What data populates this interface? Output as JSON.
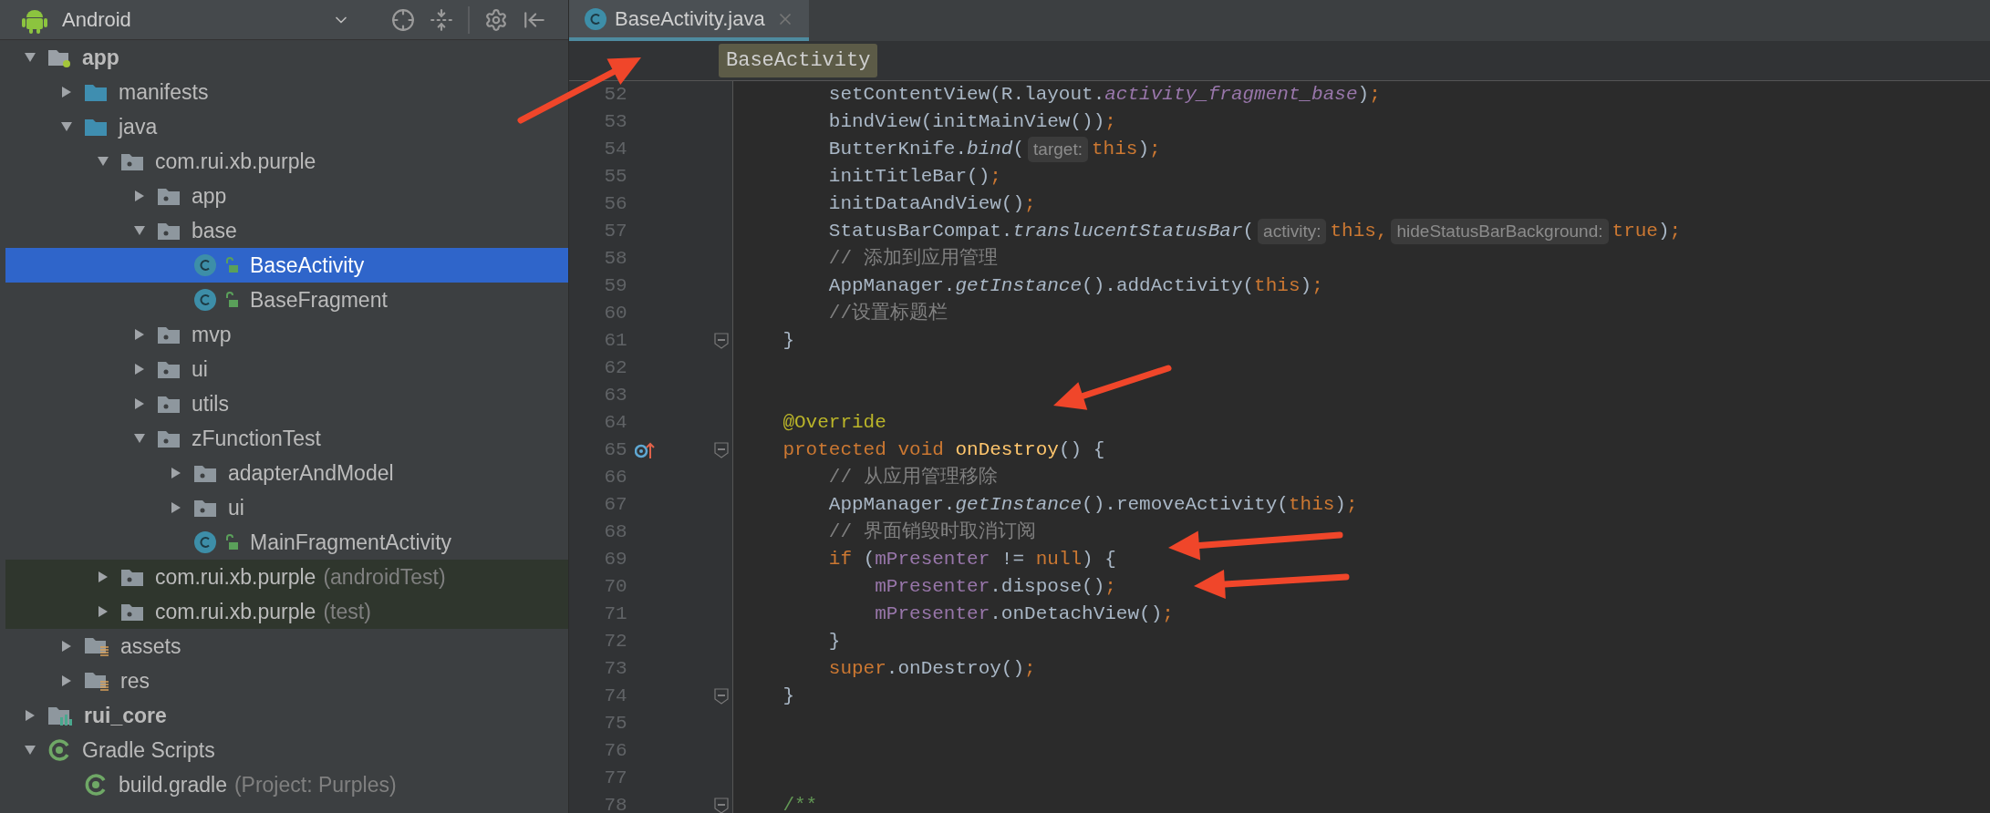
{
  "project_panel": {
    "view_selector": "Android",
    "tree": [
      {
        "label": "app",
        "kind": "module",
        "bold": true,
        "expanded": true,
        "selected": false,
        "test_scope": false,
        "children": [
          {
            "label": "manifests",
            "kind": "source-folder",
            "bold": false,
            "expanded": false,
            "selected": false,
            "test_scope": false
          },
          {
            "label": "java",
            "kind": "source-folder",
            "bold": false,
            "expanded": true,
            "selected": false,
            "test_scope": false,
            "children": [
              {
                "label": "com.rui.xb.purple",
                "kind": "package",
                "bold": false,
                "expanded": true,
                "selected": false,
                "test_scope": false,
                "children": [
                  {
                    "label": "app",
                    "kind": "package",
                    "bold": false,
                    "expanded": false,
                    "selected": false,
                    "test_scope": false
                  },
                  {
                    "label": "base",
                    "kind": "package",
                    "bold": false,
                    "expanded": true,
                    "selected": false,
                    "test_scope": false,
                    "children": [
                      {
                        "label": "BaseActivity",
                        "kind": "class",
                        "bold": false,
                        "selected": true,
                        "test_scope": false
                      },
                      {
                        "label": "BaseFragment",
                        "kind": "class",
                        "bold": false,
                        "selected": false,
                        "test_scope": false
                      }
                    ]
                  },
                  {
                    "label": "mvp",
                    "kind": "package",
                    "bold": false,
                    "expanded": false,
                    "selected": false,
                    "test_scope": false
                  },
                  {
                    "label": "ui",
                    "kind": "package",
                    "bold": false,
                    "expanded": false,
                    "selected": false,
                    "test_scope": false
                  },
                  {
                    "label": "utils",
                    "kind": "package",
                    "bold": false,
                    "expanded": false,
                    "selected": false,
                    "test_scope": false
                  },
                  {
                    "label": "zFunctionTest",
                    "kind": "package",
                    "bold": false,
                    "expanded": true,
                    "selected": false,
                    "test_scope": false,
                    "children": [
                      {
                        "label": "adapterAndModel",
                        "kind": "package",
                        "bold": false,
                        "expanded": false,
                        "selected": false,
                        "test_scope": false
                      },
                      {
                        "label": "ui",
                        "kind": "package",
                        "bold": false,
                        "expanded": false,
                        "selected": false,
                        "test_scope": false
                      },
                      {
                        "label": "MainFragmentActivity",
                        "kind": "class",
                        "bold": false,
                        "selected": false,
                        "test_scope": false
                      }
                    ]
                  }
                ]
              },
              {
                "label": "com.rui.xb.purple",
                "note": "(androidTest)",
                "kind": "package",
                "bold": false,
                "expanded": false,
                "selected": false,
                "test_scope": true
              },
              {
                "label": "com.rui.xb.purple",
                "note": "(test)",
                "kind": "package",
                "bold": false,
                "expanded": false,
                "selected": false,
                "test_scope": true
              }
            ]
          },
          {
            "label": "assets",
            "kind": "resource-folder",
            "bold": false,
            "expanded": false,
            "selected": false,
            "test_scope": false
          },
          {
            "label": "res",
            "kind": "resource-folder",
            "bold": false,
            "expanded": false,
            "selected": false,
            "test_scope": false
          }
        ]
      },
      {
        "label": "rui_core",
        "kind": "library-module",
        "bold": true,
        "expanded": false,
        "selected": false,
        "test_scope": false
      },
      {
        "label": "Gradle Scripts",
        "kind": "gradle",
        "bold": false,
        "expanded": true,
        "selected": false,
        "test_scope": false,
        "children": [
          {
            "label": "build.gradle",
            "note": "(Project: Purples)",
            "kind": "gradle",
            "bold": false,
            "selected": false,
            "test_scope": false
          }
        ]
      }
    ]
  },
  "editor": {
    "tabs": [
      {
        "label": "BaseActivity.java",
        "selected": true
      }
    ],
    "breadcrumb": "BaseActivity",
    "lines": [
      {
        "number": "52",
        "fold": false,
        "override": false,
        "tokens": [
          {
            "t": "        setContentView(R.layout.",
            "kind": "plain"
          },
          {
            "t": "activity_fragment_base",
            "kind": "static-field"
          },
          {
            "t": ")",
            "kind": "plain"
          },
          {
            "t": ";",
            "kind": "kw"
          }
        ]
      },
      {
        "number": "53",
        "fold": false,
        "override": false,
        "tokens": [
          {
            "t": "        bindView(initMainView())",
            "kind": "plain"
          },
          {
            "t": ";",
            "kind": "kw"
          }
        ]
      },
      {
        "number": "54",
        "fold": false,
        "override": false,
        "tokens": [
          {
            "t": "        ButterKnife.",
            "kind": "plain"
          },
          {
            "t": "bind",
            "kind": "static"
          },
          {
            "t": "(",
            "kind": "plain"
          },
          {
            "t": "target:",
            "kind": "hint"
          },
          {
            "t": "this",
            "kind": "kw"
          },
          {
            "t": ")",
            "kind": "plain"
          },
          {
            "t": ";",
            "kind": "kw"
          }
        ]
      },
      {
        "number": "55",
        "fold": false,
        "override": false,
        "tokens": [
          {
            "t": "        initTitleBar()",
            "kind": "plain"
          },
          {
            "t": ";",
            "kind": "kw"
          }
        ]
      },
      {
        "number": "56",
        "fold": false,
        "override": false,
        "tokens": [
          {
            "t": "        initDataAndView()",
            "kind": "plain"
          },
          {
            "t": ";",
            "kind": "kw"
          }
        ]
      },
      {
        "number": "57",
        "fold": false,
        "override": false,
        "tokens": [
          {
            "t": "        StatusBarCompat.",
            "kind": "plain"
          },
          {
            "t": "translucentStatusBar",
            "kind": "static"
          },
          {
            "t": "(",
            "kind": "plain"
          },
          {
            "t": "activity:",
            "kind": "hint"
          },
          {
            "t": "this,",
            "kind": "kw"
          },
          {
            "t": "hideStatusBarBackground:",
            "kind": "hint"
          },
          {
            "t": "true",
            "kind": "kw"
          },
          {
            "t": ")",
            "kind": "plain"
          },
          {
            "t": ";",
            "kind": "kw"
          }
        ]
      },
      {
        "number": "58",
        "fold": false,
        "override": false,
        "tokens": [
          {
            "t": "        // 添加到应用管理",
            "kind": "comment"
          }
        ]
      },
      {
        "number": "59",
        "fold": false,
        "override": false,
        "tokens": [
          {
            "t": "        AppManager.",
            "kind": "plain"
          },
          {
            "t": "getInstance",
            "kind": "static"
          },
          {
            "t": "().addActivity(",
            "kind": "plain"
          },
          {
            "t": "this",
            "kind": "kw"
          },
          {
            "t": ")",
            "kind": "plain"
          },
          {
            "t": ";",
            "kind": "kw"
          }
        ]
      },
      {
        "number": "60",
        "fold": false,
        "override": false,
        "tokens": [
          {
            "t": "        //设置标题栏",
            "kind": "comment"
          }
        ]
      },
      {
        "number": "61",
        "fold": true,
        "override": false,
        "tokens": [
          {
            "t": "    }",
            "kind": "plain"
          }
        ]
      },
      {
        "number": "62",
        "fold": false,
        "override": false
      },
      {
        "number": "63",
        "fold": false,
        "override": false
      },
      {
        "number": "64",
        "fold": false,
        "override": false,
        "tokens": [
          {
            "t": "    @Override",
            "kind": "annotation"
          }
        ]
      },
      {
        "number": "65",
        "fold": true,
        "override": true,
        "tokens": [
          {
            "t": "    protected void ",
            "kind": "kw"
          },
          {
            "t": "onDestroy",
            "kind": "decl"
          },
          {
            "t": "() {",
            "kind": "plain"
          }
        ]
      },
      {
        "number": "66",
        "fold": false,
        "override": false,
        "tokens": [
          {
            "t": "        // 从应用管理移除",
            "kind": "comment"
          }
        ]
      },
      {
        "number": "67",
        "fold": false,
        "override": false,
        "tokens": [
          {
            "t": "        AppManager.",
            "kind": "plain"
          },
          {
            "t": "getInstance",
            "kind": "static"
          },
          {
            "t": "().removeActivity(",
            "kind": "plain"
          },
          {
            "t": "this",
            "kind": "kw"
          },
          {
            "t": ")",
            "kind": "plain"
          },
          {
            "t": ";",
            "kind": "kw"
          }
        ]
      },
      {
        "number": "68",
        "fold": false,
        "override": false,
        "tokens": [
          {
            "t": "        // 界面销毁时取消订阅",
            "kind": "comment"
          }
        ]
      },
      {
        "number": "69",
        "fold": false,
        "override": false,
        "tokens": [
          {
            "t": "        if ",
            "kind": "kw"
          },
          {
            "t": "(",
            "kind": "plain"
          },
          {
            "t": "mPresenter",
            "kind": "field"
          },
          {
            "t": " != ",
            "kind": "plain"
          },
          {
            "t": "null",
            "kind": "kw"
          },
          {
            "t": ") {",
            "kind": "plain"
          }
        ]
      },
      {
        "number": "70",
        "fold": false,
        "override": false,
        "tokens": [
          {
            "t": "            mPresenter",
            "kind": "field"
          },
          {
            "t": ".dispose()",
            "kind": "plain"
          },
          {
            "t": ";",
            "kind": "kw"
          }
        ]
      },
      {
        "number": "71",
        "fold": false,
        "override": false,
        "tokens": [
          {
            "t": "            mPresenter",
            "kind": "field"
          },
          {
            "t": ".onDetachView()",
            "kind": "plain"
          },
          {
            "t": ";",
            "kind": "kw"
          }
        ]
      },
      {
        "number": "72",
        "fold": false,
        "override": false,
        "tokens": [
          {
            "t": "        }",
            "kind": "plain"
          }
        ]
      },
      {
        "number": "73",
        "fold": false,
        "override": false,
        "tokens": [
          {
            "t": "        super",
            "kind": "kw"
          },
          {
            "t": ".onDestroy()",
            "kind": "plain"
          },
          {
            "t": ";",
            "kind": "kw"
          }
        ]
      },
      {
        "number": "74",
        "fold": true,
        "override": false,
        "tokens": [
          {
            "t": "    }",
            "kind": "plain"
          }
        ]
      },
      {
        "number": "75",
        "fold": false,
        "override": false
      },
      {
        "number": "76",
        "fold": false,
        "override": false
      },
      {
        "number": "77",
        "fold": false,
        "override": false
      },
      {
        "number": "78",
        "fold": true,
        "override": false,
        "tokens": [
          {
            "t": "    /**",
            "kind": "doc"
          }
        ]
      }
    ]
  }
}
